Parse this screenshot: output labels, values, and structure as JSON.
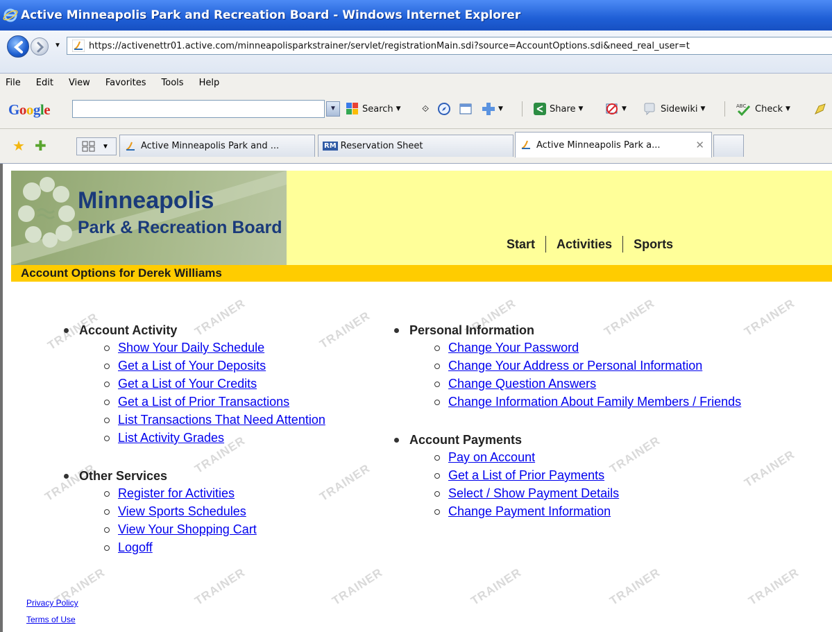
{
  "window": {
    "title": "Active Minneapolis Park and Recreation Board - Windows Internet Explorer",
    "url": "https://activenettr01.active.com/minneapolisparkstrainer/servlet/registrationMain.sdi?source=AccountOptions.sdi&need_real_user=t"
  },
  "menu": [
    "File",
    "Edit",
    "View",
    "Favorites",
    "Tools",
    "Help"
  ],
  "google_toolbar": {
    "logo": "Google",
    "search_label": "Search",
    "share_label": "Share",
    "sidewiki_label": "Sidewiki",
    "check_label": "Check"
  },
  "tabs": [
    {
      "label": "Active Minneapolis Park and ...",
      "icon": "active-favicon"
    },
    {
      "label": "Reservation Sheet",
      "icon": "rm-favicon",
      "icon_text": "RM"
    },
    {
      "label": "Active Minneapolis Park a...",
      "icon": "active-favicon",
      "active": true
    }
  ],
  "site": {
    "logo_title": "Minneapolis",
    "logo_subtitle": "Park & Recreation Board",
    "nav": [
      "Start",
      "Activities",
      "Sports"
    ],
    "account_title": "Account Options for Derek Williams",
    "watermark": "TRAINER"
  },
  "sections": {
    "account_activity": {
      "title": "Account Activity",
      "links": [
        "Show Your Daily Schedule",
        "Get a List of Your Deposits",
        "Get a List of Your Credits",
        "Get a List of Prior Transactions",
        "List Transactions That Need Attention",
        "List Activity Grades"
      ]
    },
    "other_services": {
      "title": "Other Services",
      "links": [
        "Register for Activities",
        "View Sports Schedules",
        "View Your Shopping Cart",
        "Logoff"
      ]
    },
    "personal_information": {
      "title": "Personal Information",
      "links": [
        "Change Your Password",
        "Change Your Address or Personal Information",
        "Change Question Answers",
        "Change Information About Family Members / Friends"
      ]
    },
    "account_payments": {
      "title": "Account Payments",
      "links": [
        "Pay on Account",
        "Get a List of Prior Payments",
        "Select / Show Payment Details",
        "Change Payment Information"
      ]
    }
  },
  "footer": {
    "privacy": "Privacy Policy",
    "terms": "Terms of Use"
  }
}
